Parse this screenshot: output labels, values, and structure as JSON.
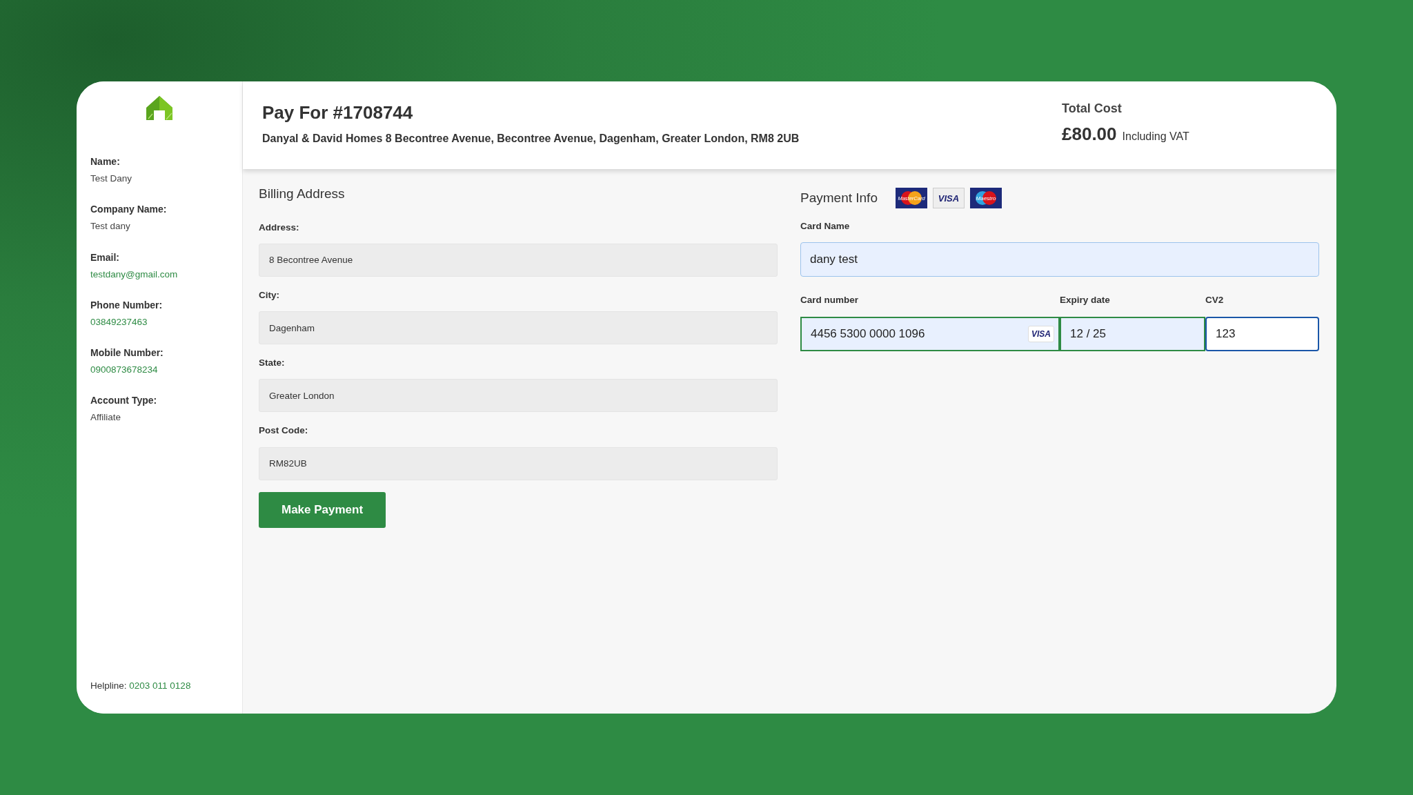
{
  "sidebar": {
    "fields": [
      {
        "label": "Name:",
        "value": "Test Dany",
        "kind": "text"
      },
      {
        "label": "Company Name:",
        "value": "Test dany",
        "kind": "text"
      },
      {
        "label": "Email:",
        "value": "testdany@gmail.com",
        "kind": "link"
      },
      {
        "label": "Phone Number:",
        "value": "03849237463",
        "kind": "link"
      },
      {
        "label": "Mobile Number:",
        "value": "0900873678234",
        "kind": "link"
      },
      {
        "label": "Account Type:",
        "value": "Affiliate",
        "kind": "text"
      }
    ],
    "helpline": {
      "label": "Helpline:",
      "value": "0203 011 0128"
    }
  },
  "header": {
    "title": "Pay For #1708744",
    "address": "Danyal & David Homes 8 Becontree Avenue, Becontree Avenue, Dagenham, Greater London, RM8 2UB",
    "total_label": "Total Cost",
    "total": "£80.00",
    "total_note": "Including VAT"
  },
  "billing": {
    "title": "Billing Address",
    "fields": [
      {
        "label": "Address:",
        "value": "8 Becontree Avenue"
      },
      {
        "label": "City:",
        "value": "Dagenham"
      },
      {
        "label": "State:",
        "value": "Greater London"
      },
      {
        "label": "Post Code:",
        "value": "RM82UB"
      }
    ],
    "button": "Make Payment"
  },
  "payment": {
    "title": "Payment Info",
    "card_brands": [
      {
        "kind": "mastercard",
        "text": "MasterCard"
      },
      {
        "kind": "visa",
        "text": "VISA"
      },
      {
        "kind": "maestro",
        "text": "Maestro"
      }
    ],
    "card_name": {
      "label": "Card Name",
      "value": "dany test",
      "autofilled": true,
      "valid": false,
      "focused": false
    },
    "card_fields": [
      {
        "label": "Card number",
        "value": "4456 5300 0000 1096",
        "brand": "VISA",
        "autofilled": true,
        "valid": true,
        "focused": false
      },
      {
        "label": "Expiry date",
        "value": "12 / 25",
        "autofilled": true,
        "valid": true,
        "focused": false
      },
      {
        "label": "CV2",
        "value": "123",
        "autofilled": false,
        "valid": false,
        "focused": true
      }
    ]
  }
}
